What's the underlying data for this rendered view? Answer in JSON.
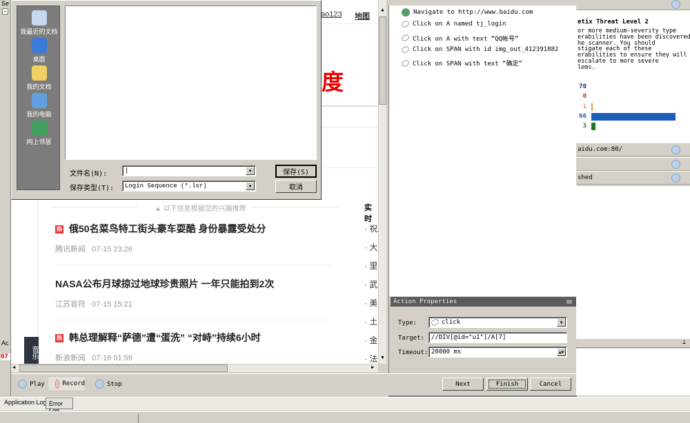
{
  "left_strip": {
    "top_text": "Se",
    "collapse": "−",
    "side_label": "Ac",
    "side_value": "07"
  },
  "browser": {
    "nav_links": [
      "ao123",
      "地图"
    ],
    "logo_fragment": "度",
    "recommend_text": "以下信息根据您的兴趣推荐",
    "side_heading": "实时",
    "side_bullets": [
      "祝",
      "大",
      "里",
      "武",
      "美",
      "土",
      "金",
      "法"
    ],
    "news": [
      {
        "hot": true,
        "title": "俄50名菜鸟特工街头豪车耍酷 身份暴露受处分",
        "source": "腾讯新闻",
        "time": "07-15 23:26"
      },
      {
        "hot": false,
        "title": "NASA公布月球掠过地球珍贵照片 一年只能拍到2次",
        "source": "江苏音符",
        "time": "07-15 15:21"
      },
      {
        "hot": true,
        "title": "韩总理解释“萨德”遭“蛋洗” “对峙”持续6小时",
        "source": "新浪新闻",
        "time": "07-16 01:59"
      }
    ],
    "hot_badge": "热",
    "music_tab": "音乐"
  },
  "save_dialog": {
    "places": [
      "我最近的文档",
      "桌面",
      "我的文档",
      "我的电脑",
      "网上邻居"
    ],
    "filename_label": "文件名(N):",
    "filename_value": "",
    "filetype_label": "保存类型(T):",
    "filetype_value": "Login Sequence (*.lsr)",
    "save_button": "保存(S)",
    "cancel_button": "取消"
  },
  "recorder": {
    "play": "Play",
    "record": "Record",
    "stop": "Stop"
  },
  "steps": [
    {
      "icon": "globe-icon",
      "text": "Navigate to http://www.baidu.com"
    },
    {
      "icon": "mouse-icon",
      "text": "Click on A named tj_login"
    },
    {
      "icon": "mouse-icon",
      "text": "Click on A with text “QQ帐号”"
    },
    {
      "icon": "mouse-icon",
      "text": "Click on SPAN with id img_out_412391882"
    },
    {
      "icon": "mouse-icon",
      "text": "Click on SPAN with text “确定”"
    }
  ],
  "action_properties": {
    "title": "Action Properties",
    "type_label": "Type:",
    "type_value": "click",
    "target_label": "Target:",
    "target_value": "//DIV[@id=\"u1\"]/A[7]",
    "timeout_label": "Timeout:",
    "timeout_value": "20000 ms"
  },
  "wizard_buttons": {
    "next": "Next",
    "finish": "Finish",
    "cancel": "Cancel"
  },
  "threat": {
    "title": "etix Threat Level 2",
    "description": "or more medium-severity type\nerabilities have been discovered\nhe scanner. You should\nstigate each of these\nerabilities to ensure they will\nescalate to more severe\nlems.",
    "counts": [
      {
        "value": "70",
        "color": "#1a2a7a",
        "fraction": 0
      },
      {
        "value": "0",
        "color": "#d02020",
        "fraction": 0
      },
      {
        "value": "1",
        "color": "#e0a040",
        "fraction": 0.015
      },
      {
        "value": "66",
        "color": "#1a5cb8",
        "fraction": 1
      },
      {
        "value": "3",
        "color": "#1a7a2a",
        "fraction": 0.05
      }
    ],
    "rows": [
      "aidu.com:80/",
      "",
      "shed"
    ]
  },
  "log_tabs": [
    "Application Log",
    "Error Log"
  ]
}
